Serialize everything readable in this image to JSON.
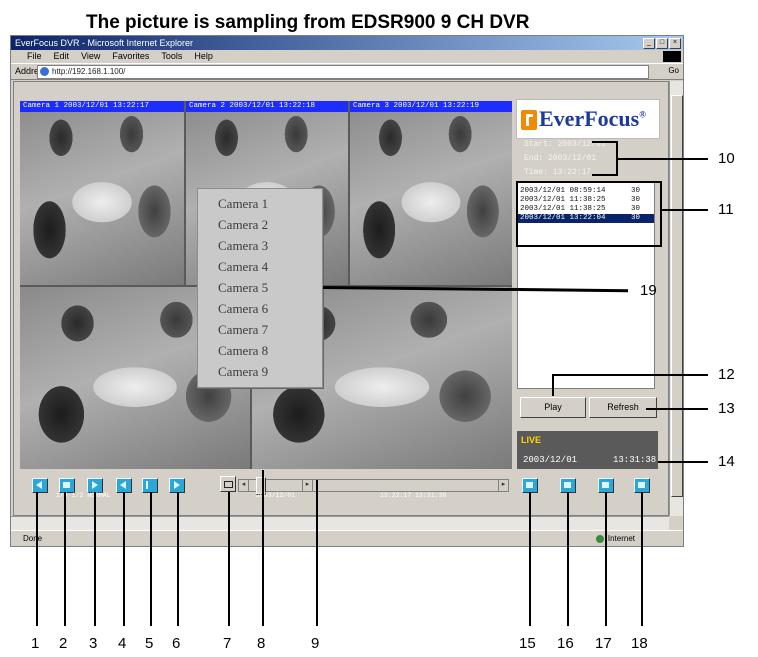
{
  "figure": {
    "title": "The picture is sampling from EDSR900 9 CH DVR"
  },
  "browser": {
    "window_title": "EverFocus DVR - Microsoft Internet Explorer",
    "menu": [
      "File",
      "Edit",
      "View",
      "Favorites",
      "Tools",
      "Help"
    ],
    "address_label": "Address",
    "address_url": "http://192.168.1.100/",
    "go_label": "Go",
    "status_text": "Done",
    "zone_text": "Internet"
  },
  "cameras": [
    {
      "label": "Camera 1  2003/12/01  13:22:17"
    },
    {
      "label": "Camera 2  2003/12/01  13:22:18"
    },
    {
      "label": "Camera 3  2003/12/01  13:22:19"
    }
  ],
  "camera_menu": {
    "items": [
      "Camera 1",
      "Camera 2",
      "Camera 3",
      "Camera 4",
      "Camera 5",
      "Camera 6",
      "Camera 7",
      "Camera 8",
      "Camera 9"
    ]
  },
  "logo": {
    "text": "EverFocus",
    "mark": "®",
    "accent": "#f08a00",
    "brand": "#1c3a9a"
  },
  "info": [
    "Start: 2003/12/01",
    "End:  2003/12/01",
    "Time:  13:22:17"
  ],
  "records": {
    "rows": [
      {
        "left": "2003/12/01 08:59:14",
        "right": "30"
      },
      {
        "left": "2003/12/01 11:38:25",
        "right": "30"
      },
      {
        "left": "2003/12/01 11:38:25",
        "right": "30"
      },
      {
        "left": "2003/12/01 13:22:04",
        "right": "30"
      }
    ],
    "selected_index": 3
  },
  "buttons": {
    "play": "Play",
    "refresh": "Refresh"
  },
  "live": {
    "label": "LIVE",
    "date": "2003/12/01",
    "time": "13:31:38",
    "label_color": "#ffd400"
  },
  "toolbar": {
    "caption_left": "1/4  1/2  NORMAL",
    "caption_mid": "2003/12/01",
    "caption_right": "13:22:17  13:31:38"
  },
  "callouts": {
    "bottom": [
      "1",
      "2",
      "3",
      "4",
      "5",
      "6",
      "7",
      "8",
      "9",
      "15",
      "16",
      "17",
      "18"
    ],
    "c10": "10",
    "c11": "11",
    "c12": "12",
    "c13": "13",
    "c14": "14",
    "c19": "19"
  }
}
